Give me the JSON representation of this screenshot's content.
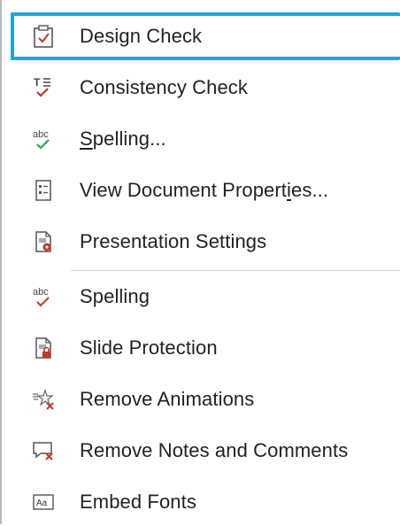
{
  "menu": {
    "items": [
      {
        "label": "Design Check",
        "icon": "clipboard-check-icon"
      },
      {
        "label": "Consistency Check",
        "icon": "text-consistency-check-icon"
      },
      {
        "label_start": "",
        "label_ul": "S",
        "label_rest": "pelling...",
        "icon": "abc-green-check-icon"
      },
      {
        "label_start": "View Document Propert",
        "label_ul": "i",
        "label_rest": "es...",
        "icon": "document-properties-icon"
      },
      {
        "label": "Presentation Settings",
        "icon": "presentation-settings-icon"
      },
      {
        "label": "Spelling",
        "icon": "abc-red-check-icon"
      },
      {
        "label": "Slide Protection",
        "icon": "slide-lock-icon"
      },
      {
        "label": "Remove Animations",
        "icon": "remove-animations-icon"
      },
      {
        "label": "Remove Notes and Comments",
        "icon": "remove-comments-icon"
      },
      {
        "label": "Embed Fonts",
        "icon": "embed-fonts-icon"
      }
    ]
  },
  "colors": {
    "selection_border": "#17a8d6",
    "check_red": "#c0392b",
    "check_green": "#2ea44f"
  }
}
